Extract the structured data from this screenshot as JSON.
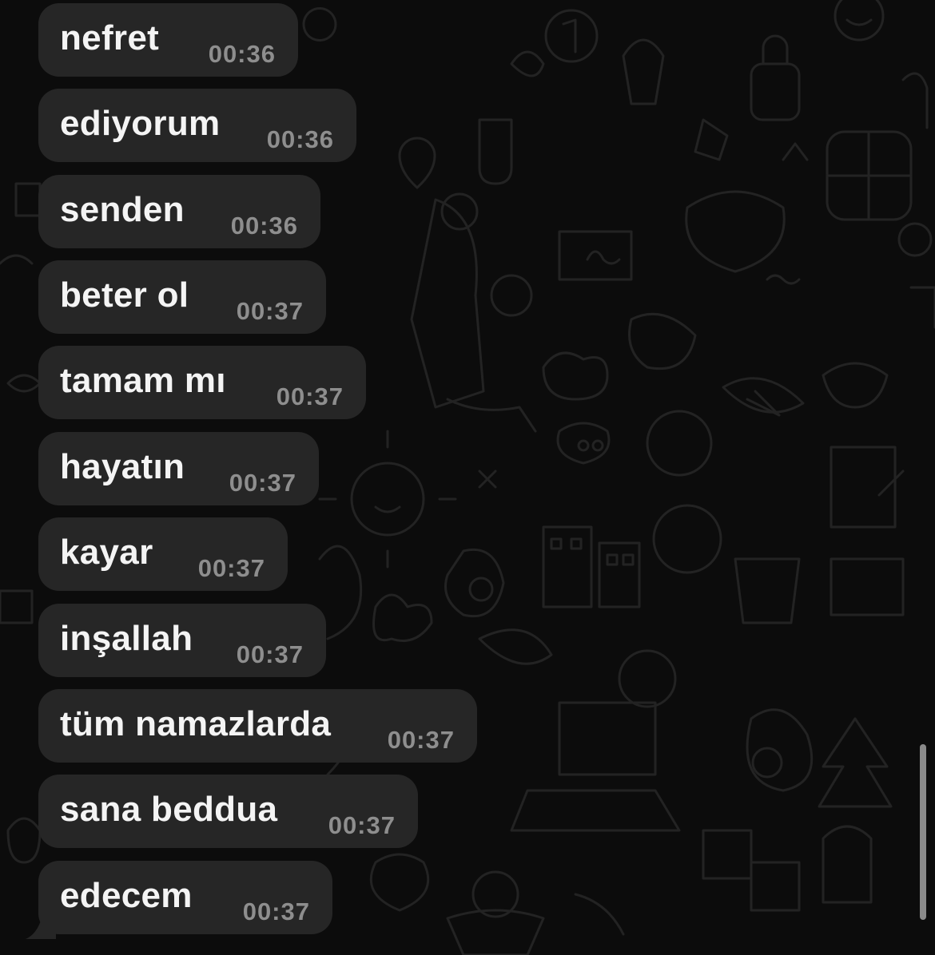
{
  "chat": {
    "messages": [
      {
        "text": "nefret",
        "time": "00:36"
      },
      {
        "text": "ediyorum",
        "time": "00:36"
      },
      {
        "text": "senden",
        "time": "00:36"
      },
      {
        "text": "beter ol",
        "time": "00:37"
      },
      {
        "text": "tamam mı",
        "time": "00:37"
      },
      {
        "text": "hayatın",
        "time": "00:37"
      },
      {
        "text": "kayar",
        "time": "00:37"
      },
      {
        "text": "inşallah",
        "time": "00:37"
      },
      {
        "text": "tüm namazlarda",
        "time": "00:37"
      },
      {
        "text": "sana beddua",
        "time": "00:37"
      },
      {
        "text": "edecem",
        "time": "00:37"
      }
    ]
  },
  "colors": {
    "background": "#0c0c0c",
    "bubble": "#262626",
    "message_text": "#f4f4f4",
    "timestamp": "#8e8e8e"
  },
  "icons": {
    "wallpaper": "doodle-pattern-icon"
  }
}
